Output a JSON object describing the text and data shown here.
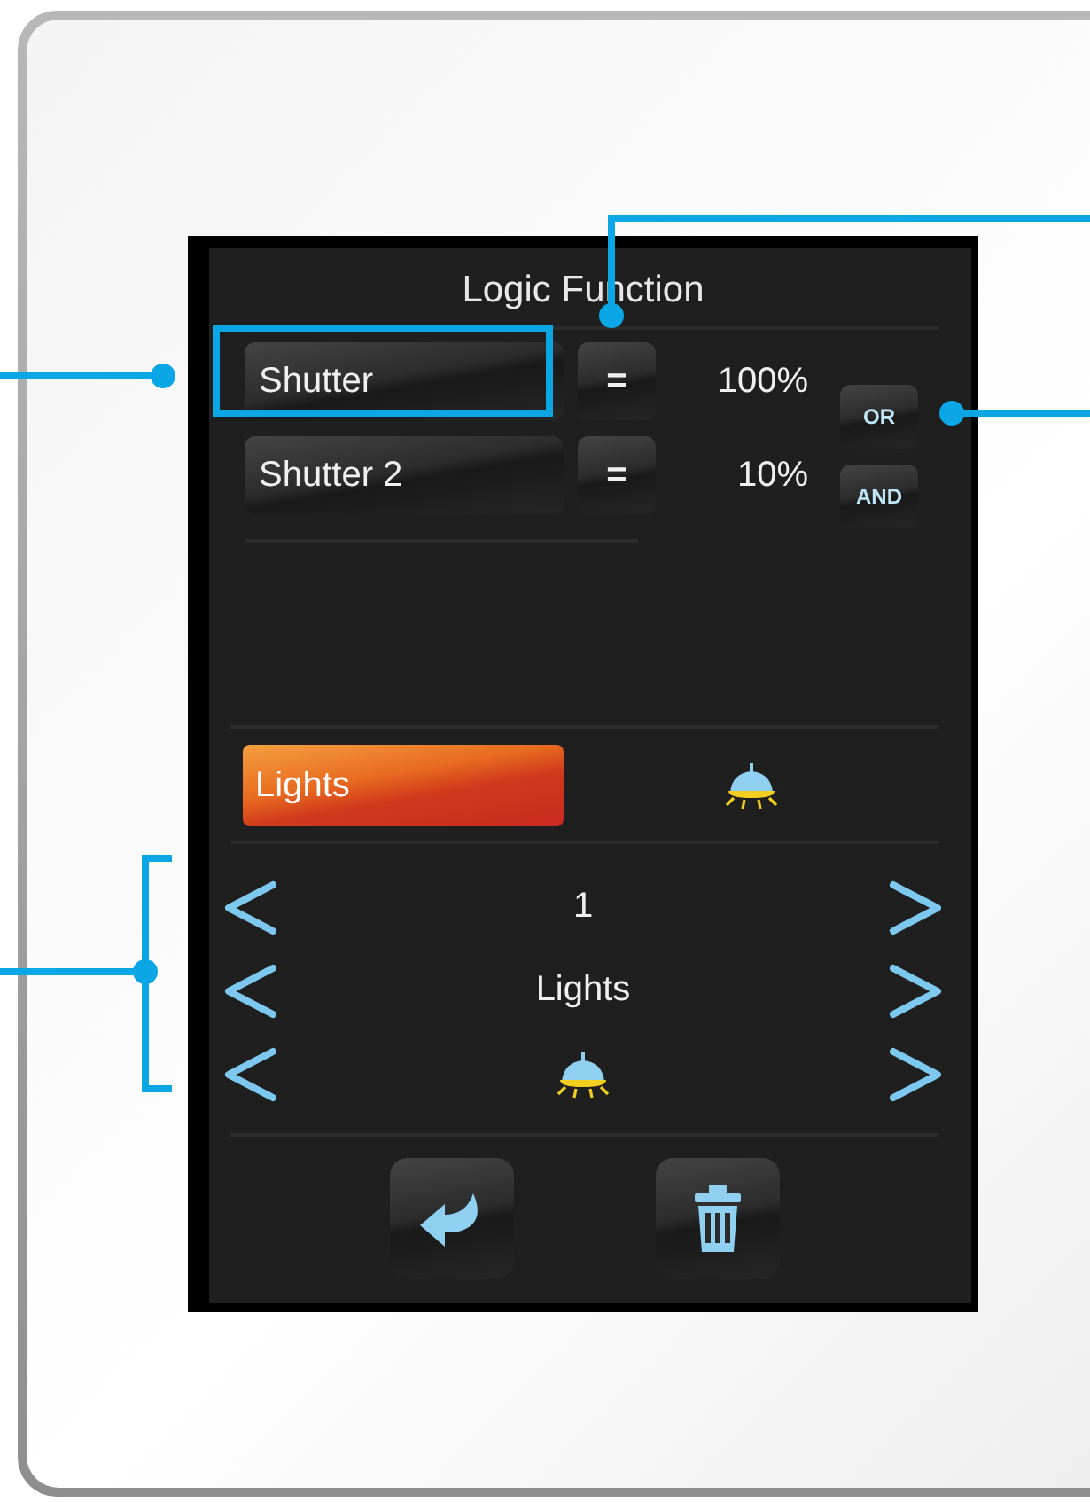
{
  "title": "Logic Function",
  "conditions": [
    {
      "name": "Shutter",
      "operator": "=",
      "value": "100%",
      "highlighted": true
    },
    {
      "name": "Shutter 2",
      "operator": "=",
      "value": "10%",
      "highlighted": false
    }
  ],
  "logic_buttons": [
    {
      "label": "OR"
    },
    {
      "label": "AND"
    }
  ],
  "output": {
    "label": "Lights",
    "selected": true
  },
  "selector_rows": [
    {
      "kind": "text",
      "value": "1"
    },
    {
      "kind": "text",
      "value": "Lights"
    },
    {
      "kind": "icon"
    }
  ]
}
